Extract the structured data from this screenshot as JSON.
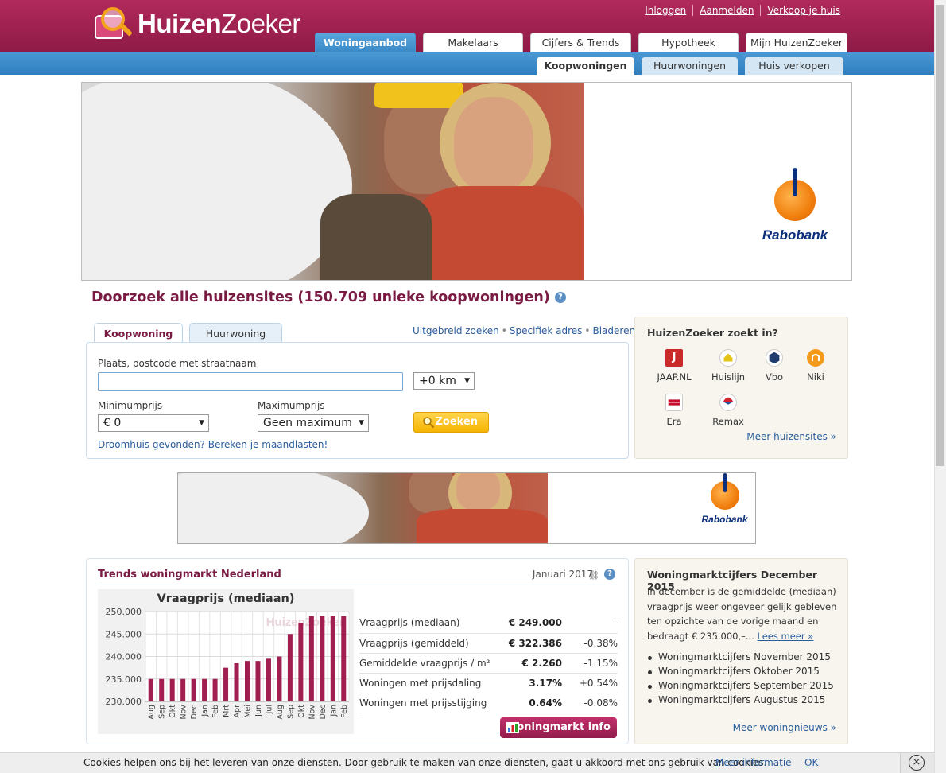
{
  "brand": {
    "name_bold": "Huizen",
    "name_light": "Zoeker"
  },
  "toplinks": [
    "Inloggen",
    "Aanmelden",
    "Verkoop je huis"
  ],
  "maintabs": [
    "Woningaanbod",
    "Makelaars",
    "Cijfers & Trends",
    "Hypotheek",
    "Mijn HuizenZoeker"
  ],
  "subtabs": [
    "Koopwoningen",
    "Huurwoningen",
    "Huis verkopen"
  ],
  "ad": {
    "bank": "Rabobank"
  },
  "headline": "Doorzoek alle huizensites (150.709 unieke koopwoningen)",
  "search": {
    "tabs": [
      "Koopwoning",
      "Huurwoning"
    ],
    "links": [
      "Uitgebreid zoeken",
      "Specifiek adres",
      "Bladeren"
    ],
    "place_label": "Plaats, postcode met straatnaam",
    "place_value": "",
    "radius": "+0 km",
    "min_label": "Minimumprijs",
    "min_value": "€ 0",
    "max_label": "Maximumprijs",
    "max_value": "Geen maximum",
    "button": "Zoeken",
    "dream_link": "Droomhuis gevonden? Bereken je maandlasten!"
  },
  "sites": {
    "title": "HuizenZoeker zoekt in?",
    "items": [
      "JAAP.NL",
      "Huislijn",
      "Vbo",
      "Niki",
      "Era",
      "Remax"
    ],
    "more": "Meer huizensites »"
  },
  "trends": {
    "title": "Trends woningmarkt Nederland",
    "date": "Januari 2017",
    "rows": [
      {
        "label": "Vraagprijs (mediaan)",
        "value": "€ 249.000",
        "change": "-",
        "dir": "none"
      },
      {
        "label": "Vraagprijs (gemiddeld)",
        "value": "€ 322.386",
        "change": "-0.38%",
        "dir": "neg"
      },
      {
        "label": "Gemiddelde vraagprijs / m²",
        "value": "€ 2.260",
        "change": "-1.15%",
        "dir": "neg"
      },
      {
        "label": "Woningen met prijsdaling",
        "value": "3.17%",
        "change": "+0.54%",
        "dir": "pos"
      },
      {
        "label": "Woningen met prijsstijging",
        "value": "0.64%",
        "change": "-0.08%",
        "dir": "neg"
      }
    ],
    "button": "Woningmarkt info"
  },
  "chart_data": {
    "type": "bar",
    "title": "Vraagprijs (mediaan)",
    "watermark": "HuizenZoeker",
    "categories": [
      "Aug",
      "Sep",
      "Okt",
      "Nov",
      "Dec",
      "Jan",
      "Feb",
      "Mrt",
      "Apr",
      "Mei",
      "Jun",
      "Jul",
      "Aug",
      "Sep",
      "Okt",
      "Nov",
      "Dec",
      "Jan",
      "Feb"
    ],
    "values": [
      235000,
      235000,
      235000,
      235000,
      235000,
      235000,
      235000,
      237500,
      238500,
      239000,
      239000,
      239500,
      240000,
      245000,
      247500,
      249000,
      249000,
      249000,
      249000
    ],
    "ylim": [
      230000,
      250000
    ],
    "yticks": [
      "250.000",
      "245.000",
      "240.000",
      "235.000",
      "230.000"
    ],
    "ytick_values": [
      250000,
      245000,
      240000,
      235000,
      230000
    ],
    "color": "#a01e50"
  },
  "news": {
    "title": "Woningmarktcijfers December 2015",
    "body": "In december is de gemiddelde (mediaan) vraagprijs weer ongeveer gelijk gebleven ten opzichte van de vorige maand en bedraagt € 235.000,–...",
    "read_more": "Lees meer »",
    "items": [
      "Woningmarktcijfers November 2015",
      "Woningmarktcijfers Oktober 2015",
      "Woningmarktcijfers September 2015",
      "Woningmarktcijfers Augustus 2015"
    ],
    "more": "Meer woningnieuws »"
  },
  "cookie": {
    "text": "Cookies helpen ons bij het leveren van onze diensten. Door gebruik te maken van onze diensten, gaat u akkoord met ons gebruik van cookies.",
    "more": "Meer informatie",
    "ok": "OK",
    "close": "×"
  }
}
